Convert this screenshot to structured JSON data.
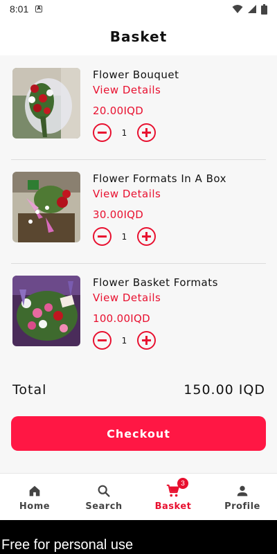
{
  "status_bar": {
    "time": "8:01",
    "notification_icon": "a-notification-icon",
    "icons": [
      "wifi-icon",
      "signal-icon",
      "battery-icon"
    ]
  },
  "header": {
    "title": "Basket"
  },
  "items": [
    {
      "name": "Flower Bouquet",
      "details_label": "View Details",
      "price": "20.00IQD",
      "quantity": "1",
      "image": "flower-bouquet-image"
    },
    {
      "name": "Flower Formats In A Box",
      "details_label": "View Details",
      "price": "30.00IQD",
      "quantity": "1",
      "image": "flower-box-image"
    },
    {
      "name": "Flower Basket Formats",
      "details_label": "View Details",
      "price": "100.00IQD",
      "quantity": "1",
      "image": "flower-basket-image"
    }
  ],
  "summary": {
    "total_label": "Total",
    "total_value": "150.00 IQD"
  },
  "checkout": {
    "label": "Checkout"
  },
  "nav": {
    "items": [
      {
        "label": "Home",
        "icon": "home-icon"
      },
      {
        "label": "Search",
        "icon": "search-icon"
      },
      {
        "label": "Basket",
        "icon": "cart-icon",
        "badge": "3"
      },
      {
        "label": "Profile",
        "icon": "person-icon"
      }
    ],
    "active": "Basket"
  },
  "watermark": "Free for personal use",
  "colors": {
    "accent": "#e8102f",
    "button": "#ff1744",
    "background": "#f7f7f7"
  }
}
